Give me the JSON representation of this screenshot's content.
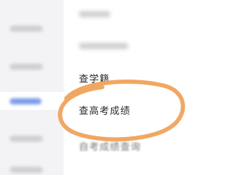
{
  "menu": {
    "items": [
      {
        "label": "查学籍"
      },
      {
        "label": "查高考成绩"
      },
      {
        "label": "自考成绩查询"
      }
    ]
  },
  "annotation": {
    "highlight_color": "#f0a25a"
  }
}
